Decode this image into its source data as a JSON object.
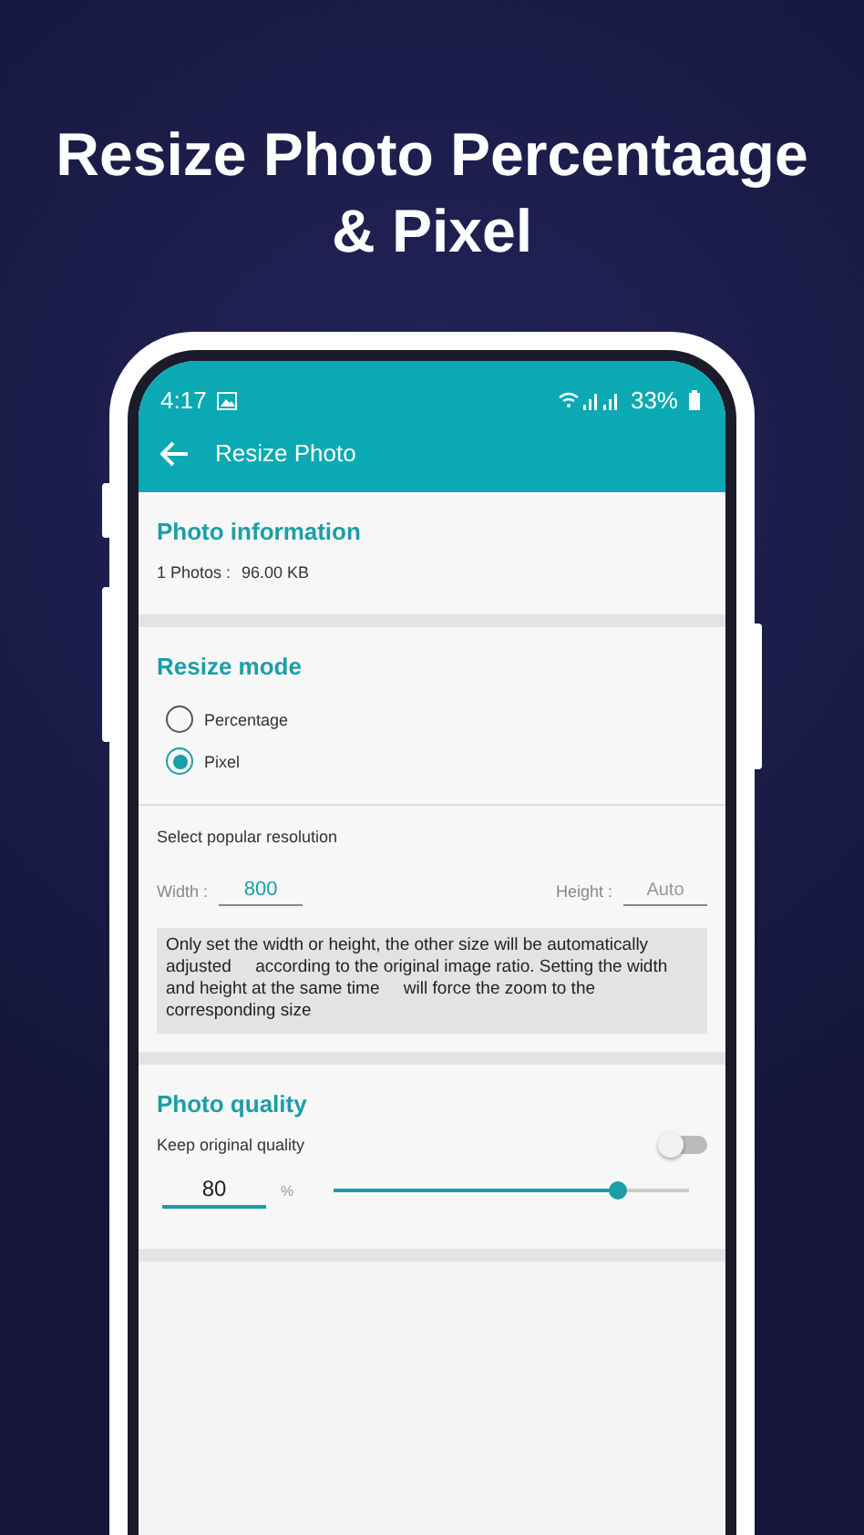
{
  "headline": "Resize Photo Percentaage & Pixel",
  "status_bar": {
    "time": "4:17",
    "battery": "33%"
  },
  "app_bar": {
    "title": "Resize Photo"
  },
  "photo_information": {
    "title": "Photo information",
    "label": "1 Photos :",
    "size": "96.00 KB"
  },
  "resize_mode": {
    "title": "Resize mode",
    "options": [
      {
        "label": "Percentage",
        "selected": false
      },
      {
        "label": "Pixel",
        "selected": true
      }
    ]
  },
  "resolution": {
    "label": "Select popular resolution",
    "width_label": "Width :",
    "width_value": "800",
    "height_label": "Height :",
    "height_placeholder": "Auto",
    "note": "Only set the width or height, the other size will be automatically adjusted     according to the original image ratio. Setting the width and height at the same time     will force the zoom to the corresponding size"
  },
  "photo_quality": {
    "title": "Photo quality",
    "keep_label": "Keep original quality",
    "keep_on": false,
    "value": "80",
    "unit": "%",
    "level": 0.8
  }
}
